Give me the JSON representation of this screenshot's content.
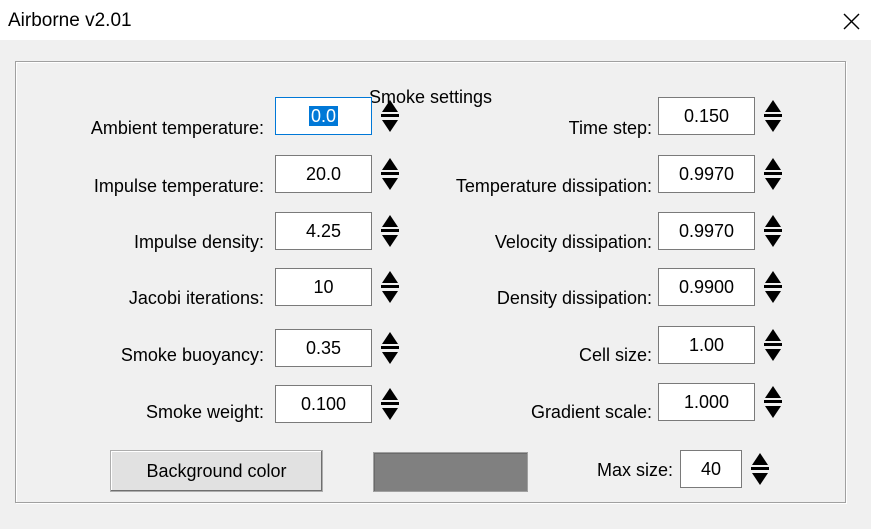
{
  "window": {
    "title": "Airborne v2.01"
  },
  "group": {
    "title": "Smoke settings"
  },
  "left_fields": [
    {
      "label": "Ambient temperature:",
      "value": "0.0"
    },
    {
      "label": "Impulse temperature:",
      "value": "20.0"
    },
    {
      "label": "Impulse density:",
      "value": "4.25"
    },
    {
      "label": "Jacobi iterations:",
      "value": "10"
    },
    {
      "label": "Smoke buoyancy:",
      "value": "0.35"
    },
    {
      "label": "Smoke weight:",
      "value": "0.100"
    }
  ],
  "right_fields": [
    {
      "label": "Time step:",
      "value": "0.150"
    },
    {
      "label": "Temperature dissipation:",
      "value": "0.9970"
    },
    {
      "label": "Velocity dissipation:",
      "value": "0.9970"
    },
    {
      "label": "Density dissipation:",
      "value": "0.9900"
    },
    {
      "label": "Cell size:",
      "value": "1.00"
    },
    {
      "label": "Gradient scale:",
      "value": "1.000"
    }
  ],
  "background_color_button": {
    "label": "Background color"
  },
  "background_swatch": {
    "color": "#808080"
  },
  "max_size": {
    "label": "Max size:",
    "value": "40"
  },
  "icons": {
    "close": "close-icon",
    "spin": "spin-up-down-icon"
  }
}
